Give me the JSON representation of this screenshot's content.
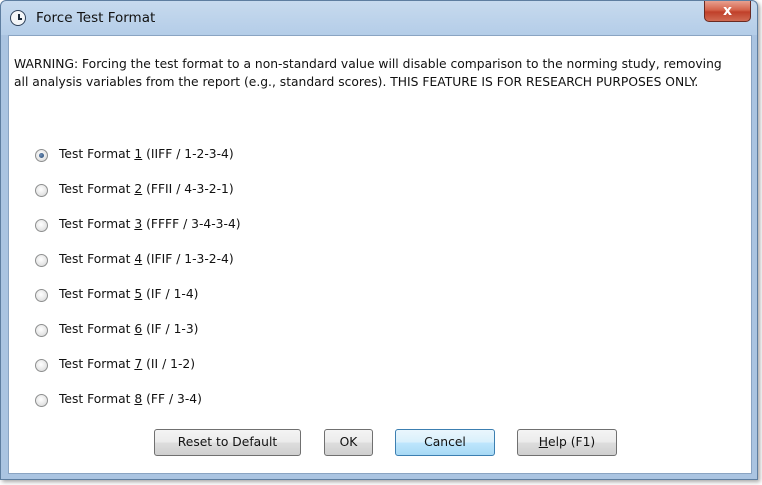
{
  "window": {
    "title": "Force Test Format",
    "close_label": "x"
  },
  "warning_text": "WARNING: Forcing the test format to a non-standard value will disable comparison to the norming study, removing all analysis variables from the report (e.g., standard scores). THIS FEATURE IS FOR RESEARCH PURPOSES ONLY.",
  "options": [
    {
      "prefix": "Test Format ",
      "mnemonic": "1",
      "suffix": " (IIFF / 1-2-3-4)",
      "checked": true
    },
    {
      "prefix": "Test Format ",
      "mnemonic": "2",
      "suffix": " (FFII / 4-3-2-1)",
      "checked": false
    },
    {
      "prefix": "Test Format ",
      "mnemonic": "3",
      "suffix": " (FFFF / 3-4-3-4)",
      "checked": false
    },
    {
      "prefix": "Test Format ",
      "mnemonic": "4",
      "suffix": " (IFIF / 1-3-2-4)",
      "checked": false
    },
    {
      "prefix": "Test Format ",
      "mnemonic": "5",
      "suffix": " (IF / 1-4)",
      "checked": false
    },
    {
      "prefix": "Test Format ",
      "mnemonic": "6",
      "suffix": " (IF / 1-3)",
      "checked": false
    },
    {
      "prefix": "Test Format ",
      "mnemonic": "7",
      "suffix": " (II / 1-2)",
      "checked": false
    },
    {
      "prefix": "Test Format ",
      "mnemonic": "8",
      "suffix": " (FF / 3-4)",
      "checked": false
    }
  ],
  "buttons": {
    "reset": "Reset to Default",
    "ok": "OK",
    "cancel": "Cancel",
    "help_mnemonic": "H",
    "help_rest": "elp (F1)"
  },
  "colors": {
    "accent": "#3c7fb1",
    "close_button": "#c7503a",
    "frame": "#aac4e1"
  },
  "icons": {
    "app": "clock-icon",
    "close": "close-icon",
    "radio_checked": "radio-checked",
    "radio_unchecked": "radio-unchecked"
  }
}
